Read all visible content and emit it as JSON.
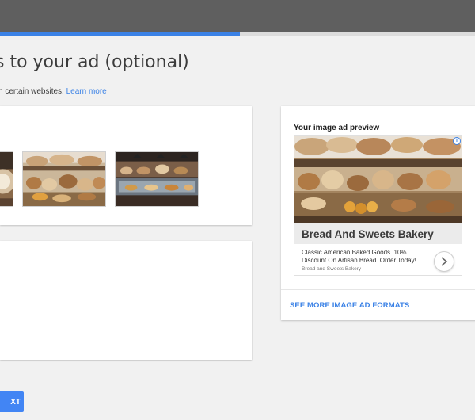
{
  "header": {
    "progress_fraction": 0.505
  },
  "page": {
    "title": "s to your ad (optional)",
    "subtitle": "n certain websites.",
    "learn_more_link": "Learn more"
  },
  "images_card": {
    "thumbnails": [
      {
        "icon": "bakery-photo-icon"
      },
      {
        "icon": "bakery-photo-icon"
      },
      {
        "icon": "bakery-photo-icon"
      }
    ]
  },
  "preview": {
    "heading": "Your image ad preview",
    "ad": {
      "headline": "Bread And Sweets Bakery",
      "description": "Classic American Baked Goods. 10% Discount On Artisan Bread. Order Today!",
      "display_url": "Bread and Sweets Bakery",
      "info_icon": "i"
    },
    "see_more": "SEE MORE IMAGE AD FORMATS"
  },
  "footer": {
    "next_label": "XT"
  },
  "colors": {
    "accent": "#3b82e6",
    "button": "#4285f4",
    "topbar": "#5f5f5f",
    "page_bg": "#f1f1f1"
  }
}
